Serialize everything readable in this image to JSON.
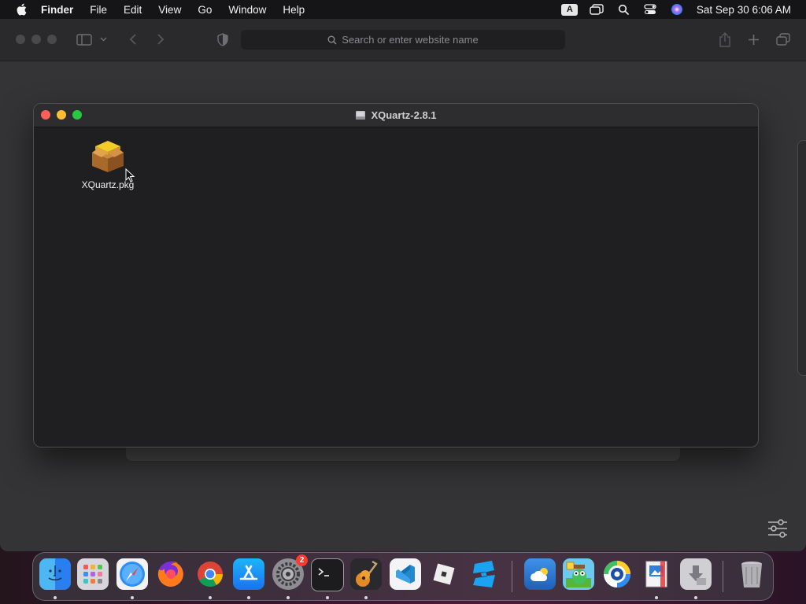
{
  "menubar": {
    "app_name": "Finder",
    "items": [
      "File",
      "Edit",
      "View",
      "Go",
      "Window",
      "Help"
    ],
    "input_source": "A",
    "datetime": "Sat Sep 30  6:06 AM"
  },
  "browser": {
    "address_placeholder": "Search or enter website name"
  },
  "finder": {
    "title": "XQuartz-2.8.1",
    "files": [
      {
        "name": "XQuartz.pkg",
        "icon": "package-icon"
      }
    ]
  },
  "dock": {
    "apps": [
      {
        "name": "Finder",
        "icon": "finder-icon",
        "running": true
      },
      {
        "name": "Launchpad",
        "icon": "launchpad-icon",
        "running": false
      },
      {
        "name": "Safari",
        "icon": "safari-icon",
        "running": true
      },
      {
        "name": "Firefox",
        "icon": "firefox-icon",
        "running": false
      },
      {
        "name": "Google Chrome",
        "icon": "chrome-icon",
        "running": true
      },
      {
        "name": "App Store",
        "icon": "app-store-icon",
        "running": true
      },
      {
        "name": "System Settings",
        "icon": "system-settings-icon",
        "running": true,
        "badge": "2"
      },
      {
        "name": "Terminal",
        "icon": "terminal-icon",
        "running": true
      },
      {
        "name": "GarageBand",
        "icon": "garageband-icon",
        "running": true
      },
      {
        "name": "Visual Studio Code",
        "icon": "vscode-icon",
        "running": false
      },
      {
        "name": "Roblox",
        "icon": "roblox-icon",
        "running": false
      },
      {
        "name": "Roblox Studio",
        "icon": "roblox-studio-icon",
        "running": false
      },
      {
        "name": "Weather",
        "icon": "weather-icon",
        "running": false
      },
      {
        "name": "Game",
        "icon": "game-icon",
        "running": false
      },
      {
        "name": "Vision App",
        "icon": "eye-app-icon",
        "running": false
      },
      {
        "name": "Preview",
        "icon": "preview-icon",
        "running": true
      },
      {
        "name": "Downloads",
        "icon": "downloads-icon",
        "running": true
      },
      {
        "name": "Trash",
        "icon": "trash-icon",
        "running": false
      }
    ]
  },
  "colors": {
    "close": "#ff5f57",
    "minimize": "#febc2e",
    "maximize": "#28c840",
    "badge": "#ff3b30"
  }
}
